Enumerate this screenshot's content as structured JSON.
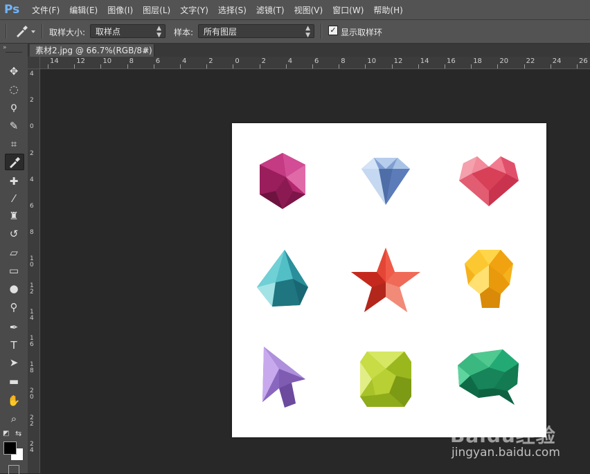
{
  "app": {
    "logo": "Ps"
  },
  "menu": [
    "文件(F)",
    "编辑(E)",
    "图像(I)",
    "图层(L)",
    "文字(Y)",
    "选择(S)",
    "滤镜(T)",
    "视图(V)",
    "窗口(W)",
    "帮助(H)"
  ],
  "options": {
    "sample_size_label": "取样大小:",
    "sample_size_value": "取样点",
    "sample_label": "样本:",
    "sample_value": "所有图层",
    "show_ring_label": "显示取样环",
    "show_ring_checked": true
  },
  "document_tab": {
    "title": "素材2.jpg @ 66.7%(RGB/8#)",
    "close": "×"
  },
  "ruler_h": [
    "14",
    "12",
    "10",
    "8",
    "6",
    "4",
    "2",
    "0",
    "2",
    "4",
    "6",
    "8",
    "10",
    "12",
    "14",
    "16",
    "18",
    "20",
    "22",
    "24",
    "26"
  ],
  "ruler_v": [
    "4",
    "2",
    "0",
    "2",
    "4",
    "6",
    "8",
    "10",
    "12",
    "14",
    "16",
    "18",
    "20",
    "22",
    "24"
  ],
  "tools": [
    "move-tool",
    "marquee-tool",
    "lasso-tool",
    "quick-select-tool",
    "crop-tool",
    "eyedropper-tool",
    "healing-brush-tool",
    "brush-tool",
    "clone-stamp-tool",
    "history-brush-tool",
    "eraser-tool",
    "gradient-tool",
    "blur-tool",
    "dodge-tool",
    "pen-tool",
    "type-tool",
    "path-select-tool",
    "rectangle-tool",
    "hand-tool",
    "zoom-tool"
  ],
  "active_tool": "eyedropper-tool",
  "colors": {
    "foreground": "#000000",
    "background": "#ffffff",
    "accent": "#6fb5ff"
  },
  "canvas_icons": [
    "hexagon-gem-icon",
    "diamond-gem-icon",
    "heart-gem-icon",
    "drop-gem-icon",
    "star-gem-icon",
    "bulb-gem-icon",
    "arrow-cursor-gem-icon",
    "square-gem-icon",
    "speech-bubble-gem-icon"
  ],
  "watermark": {
    "logo": "Baidu经验",
    "url": "jingyan.baidu.com"
  }
}
